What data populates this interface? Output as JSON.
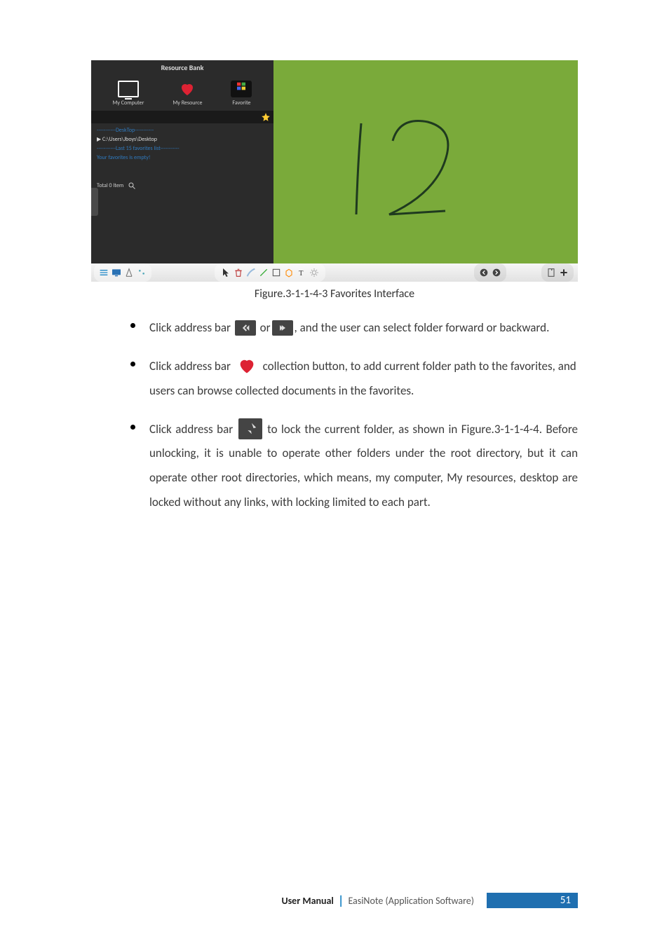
{
  "screenshot": {
    "panel_title": "Resource Bank",
    "tabs": {
      "computer": "My Computer",
      "resource": "My Resource",
      "favorite": "Favorite"
    },
    "list": {
      "group_desktop": "-----------DeskTop-----------",
      "path": "▶ C:\\Users\\Jboys\\Desktop",
      "group_last": "-----------Last 15 favorites list-----------",
      "empty": "Your favorites is empty!"
    },
    "total": "Total 0 Item"
  },
  "caption": "Figure.3-1-1-4-3 Favorites Interface",
  "b1": {
    "pre": "Click address bar ",
    "mid": " or",
    "post": ", and the user can select folder forward or backward."
  },
  "b2": {
    "pre": "Click address bar ",
    "post": " collection button, to add current folder path to the favorites, and users can browse collected documents in the favorites."
  },
  "b3": {
    "pre": "Click  address  bar ",
    "post": " to  lock  the  current  folder,  as  shown  in Figure.3-1-1-4-4. Before unlocking, it is unable to operate other folders under the root directory, but it can operate other root directories, which means, my computer, My resources, desktop are locked without any links, with locking limited to each part."
  },
  "footer": {
    "um": "User Manual",
    "app": "EasiNote (Application Software)",
    "page": "51"
  }
}
